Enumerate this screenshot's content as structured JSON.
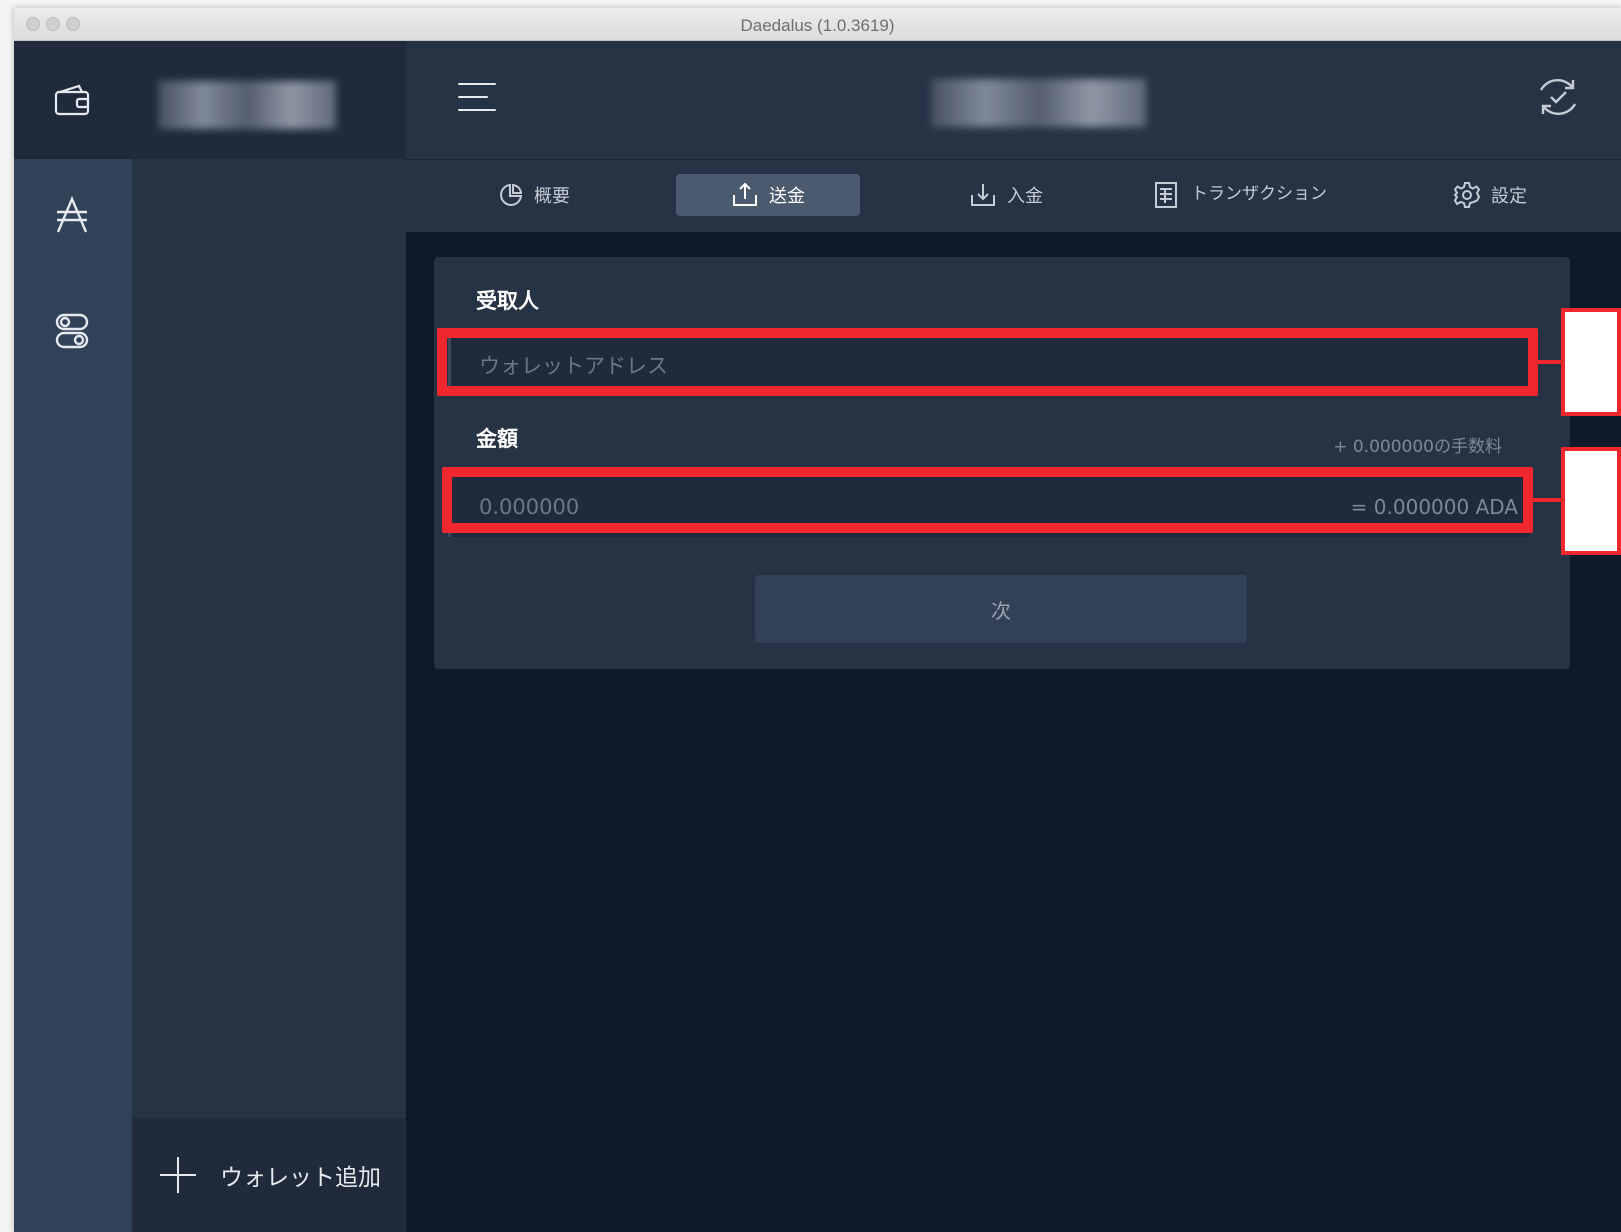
{
  "window": {
    "title": "Daedalus (1.0.3619)"
  },
  "icons": {
    "wallet": "wallet-icon",
    "ada": "ada-icon",
    "settings": "toggle-settings-icon",
    "menu": "hamburger-icon",
    "sync": "sync-check-icon"
  },
  "sidebar": {
    "add_wallet_label": "ウォレット追加"
  },
  "tabs": [
    {
      "label": "概要",
      "icon": "summary-icon"
    },
    {
      "label": "送金",
      "icon": "send-icon",
      "active": true
    },
    {
      "label": "入金",
      "icon": "receive-icon"
    },
    {
      "label": "トランザクション",
      "icon": "transactions-icon"
    },
    {
      "label": "設定",
      "icon": "settings-gear-icon"
    }
  ],
  "send_form": {
    "receiver_label": "受取人",
    "address_placeholder": "ウォレットアドレス",
    "amount_label": "金額",
    "fee_text": "+ 0.000000の手数料",
    "amount_placeholder": "0.000000",
    "conversion_text": "= 0.000000 ADA",
    "next_button": "次"
  },
  "colors": {
    "highlight": "#f0282d",
    "background": "#0d1a27",
    "panel": "#263345",
    "sidebar": "#314157"
  }
}
